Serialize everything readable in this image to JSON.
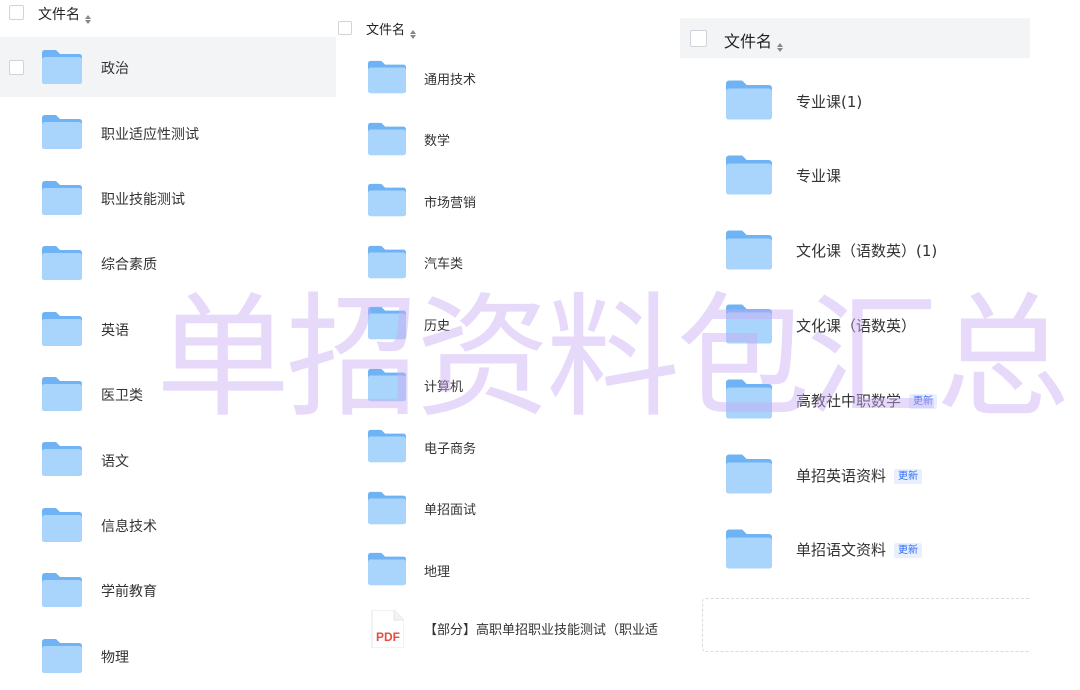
{
  "header": {
    "label": "文件名"
  },
  "panel1": {
    "items": [
      {
        "name": "政治"
      },
      {
        "name": "职业适应性测试"
      },
      {
        "name": "职业技能测试"
      },
      {
        "name": "综合素质"
      },
      {
        "name": "英语"
      },
      {
        "name": "医卫类"
      },
      {
        "name": "语文"
      },
      {
        "name": "信息技术"
      },
      {
        "name": "学前教育"
      },
      {
        "name": "物理"
      }
    ]
  },
  "panel2": {
    "items": [
      {
        "name": "通用技术"
      },
      {
        "name": "数学"
      },
      {
        "name": "市场营销"
      },
      {
        "name": "汽车类"
      },
      {
        "name": "历史"
      },
      {
        "name": "计算机"
      },
      {
        "name": "电子商务"
      },
      {
        "name": "单招面试"
      },
      {
        "name": "地理"
      }
    ],
    "pdf": {
      "name": "【部分】高职单招职业技能测试（职业适",
      "icon_text": "PDF"
    }
  },
  "panel3": {
    "items": [
      {
        "name": "专业课(1)"
      },
      {
        "name": "专业课"
      },
      {
        "name": "文化课（语数英）(1)"
      },
      {
        "name": "文化课（语数英）"
      },
      {
        "name": "高教社中职数学",
        "badge": "更新"
      },
      {
        "name": "单招英语资料",
        "badge": "更新"
      },
      {
        "name": "单招语文资料",
        "badge": "更新"
      }
    ]
  },
  "watermark": "单招资料包汇总",
  "colors": {
    "folder_light": "#a9d4fb",
    "folder_dark": "#6fb3f5",
    "badge_text": "#2d6cf6",
    "watermark": "#c8aaf5"
  }
}
